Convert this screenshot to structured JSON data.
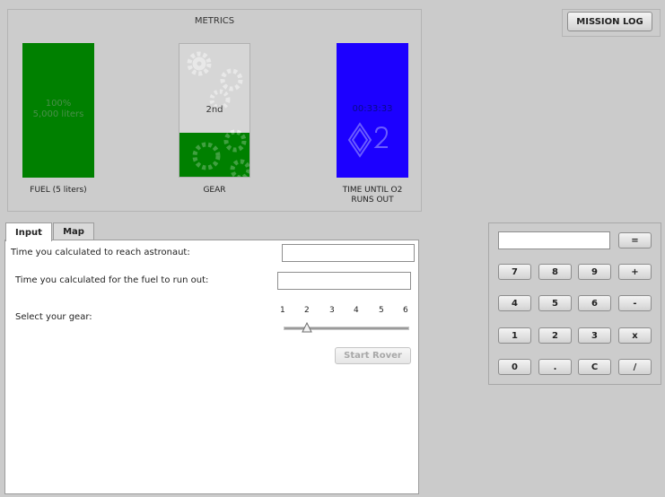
{
  "metrics": {
    "title": "METRICS",
    "fuel": {
      "line1": "100%",
      "line2": "5,000 liters",
      "label": "FUEL (5 liters)",
      "level": 1.0
    },
    "gear": {
      "value": "2nd",
      "label": "GEAR",
      "level": 0.33
    },
    "o2": {
      "value": "00:33:33",
      "label_line1": "TIME UNTIL O2",
      "label_line2": "RUNS OUT"
    }
  },
  "mission_log": {
    "label": "MISSION LOG"
  },
  "tabs": [
    {
      "label": "Input"
    },
    {
      "label": "Map"
    }
  ],
  "form": {
    "astronaut_label": "Time you calculated to reach astronaut:",
    "astronaut_value": "",
    "fuel_label": "Time you calculated for the fuel to run out:",
    "fuel_value": "",
    "gear_label": "Select your gear:",
    "gear_ticks": [
      "1",
      "2",
      "3",
      "4",
      "5",
      "6"
    ],
    "gear_selected": 2,
    "start_label": "Start Rover"
  },
  "calculator": {
    "display": "",
    "equals": "=",
    "keys": [
      [
        "7",
        "8",
        "9",
        "+"
      ],
      [
        "4",
        "5",
        "6",
        "-"
      ],
      [
        "1",
        "2",
        "3",
        "x"
      ],
      [
        "0",
        ".",
        "C",
        "/"
      ]
    ]
  },
  "colors": {
    "fuel": "#008000",
    "gear_fill": "#008000",
    "o2": "#1c00ff",
    "background": "#cbcbcb"
  }
}
